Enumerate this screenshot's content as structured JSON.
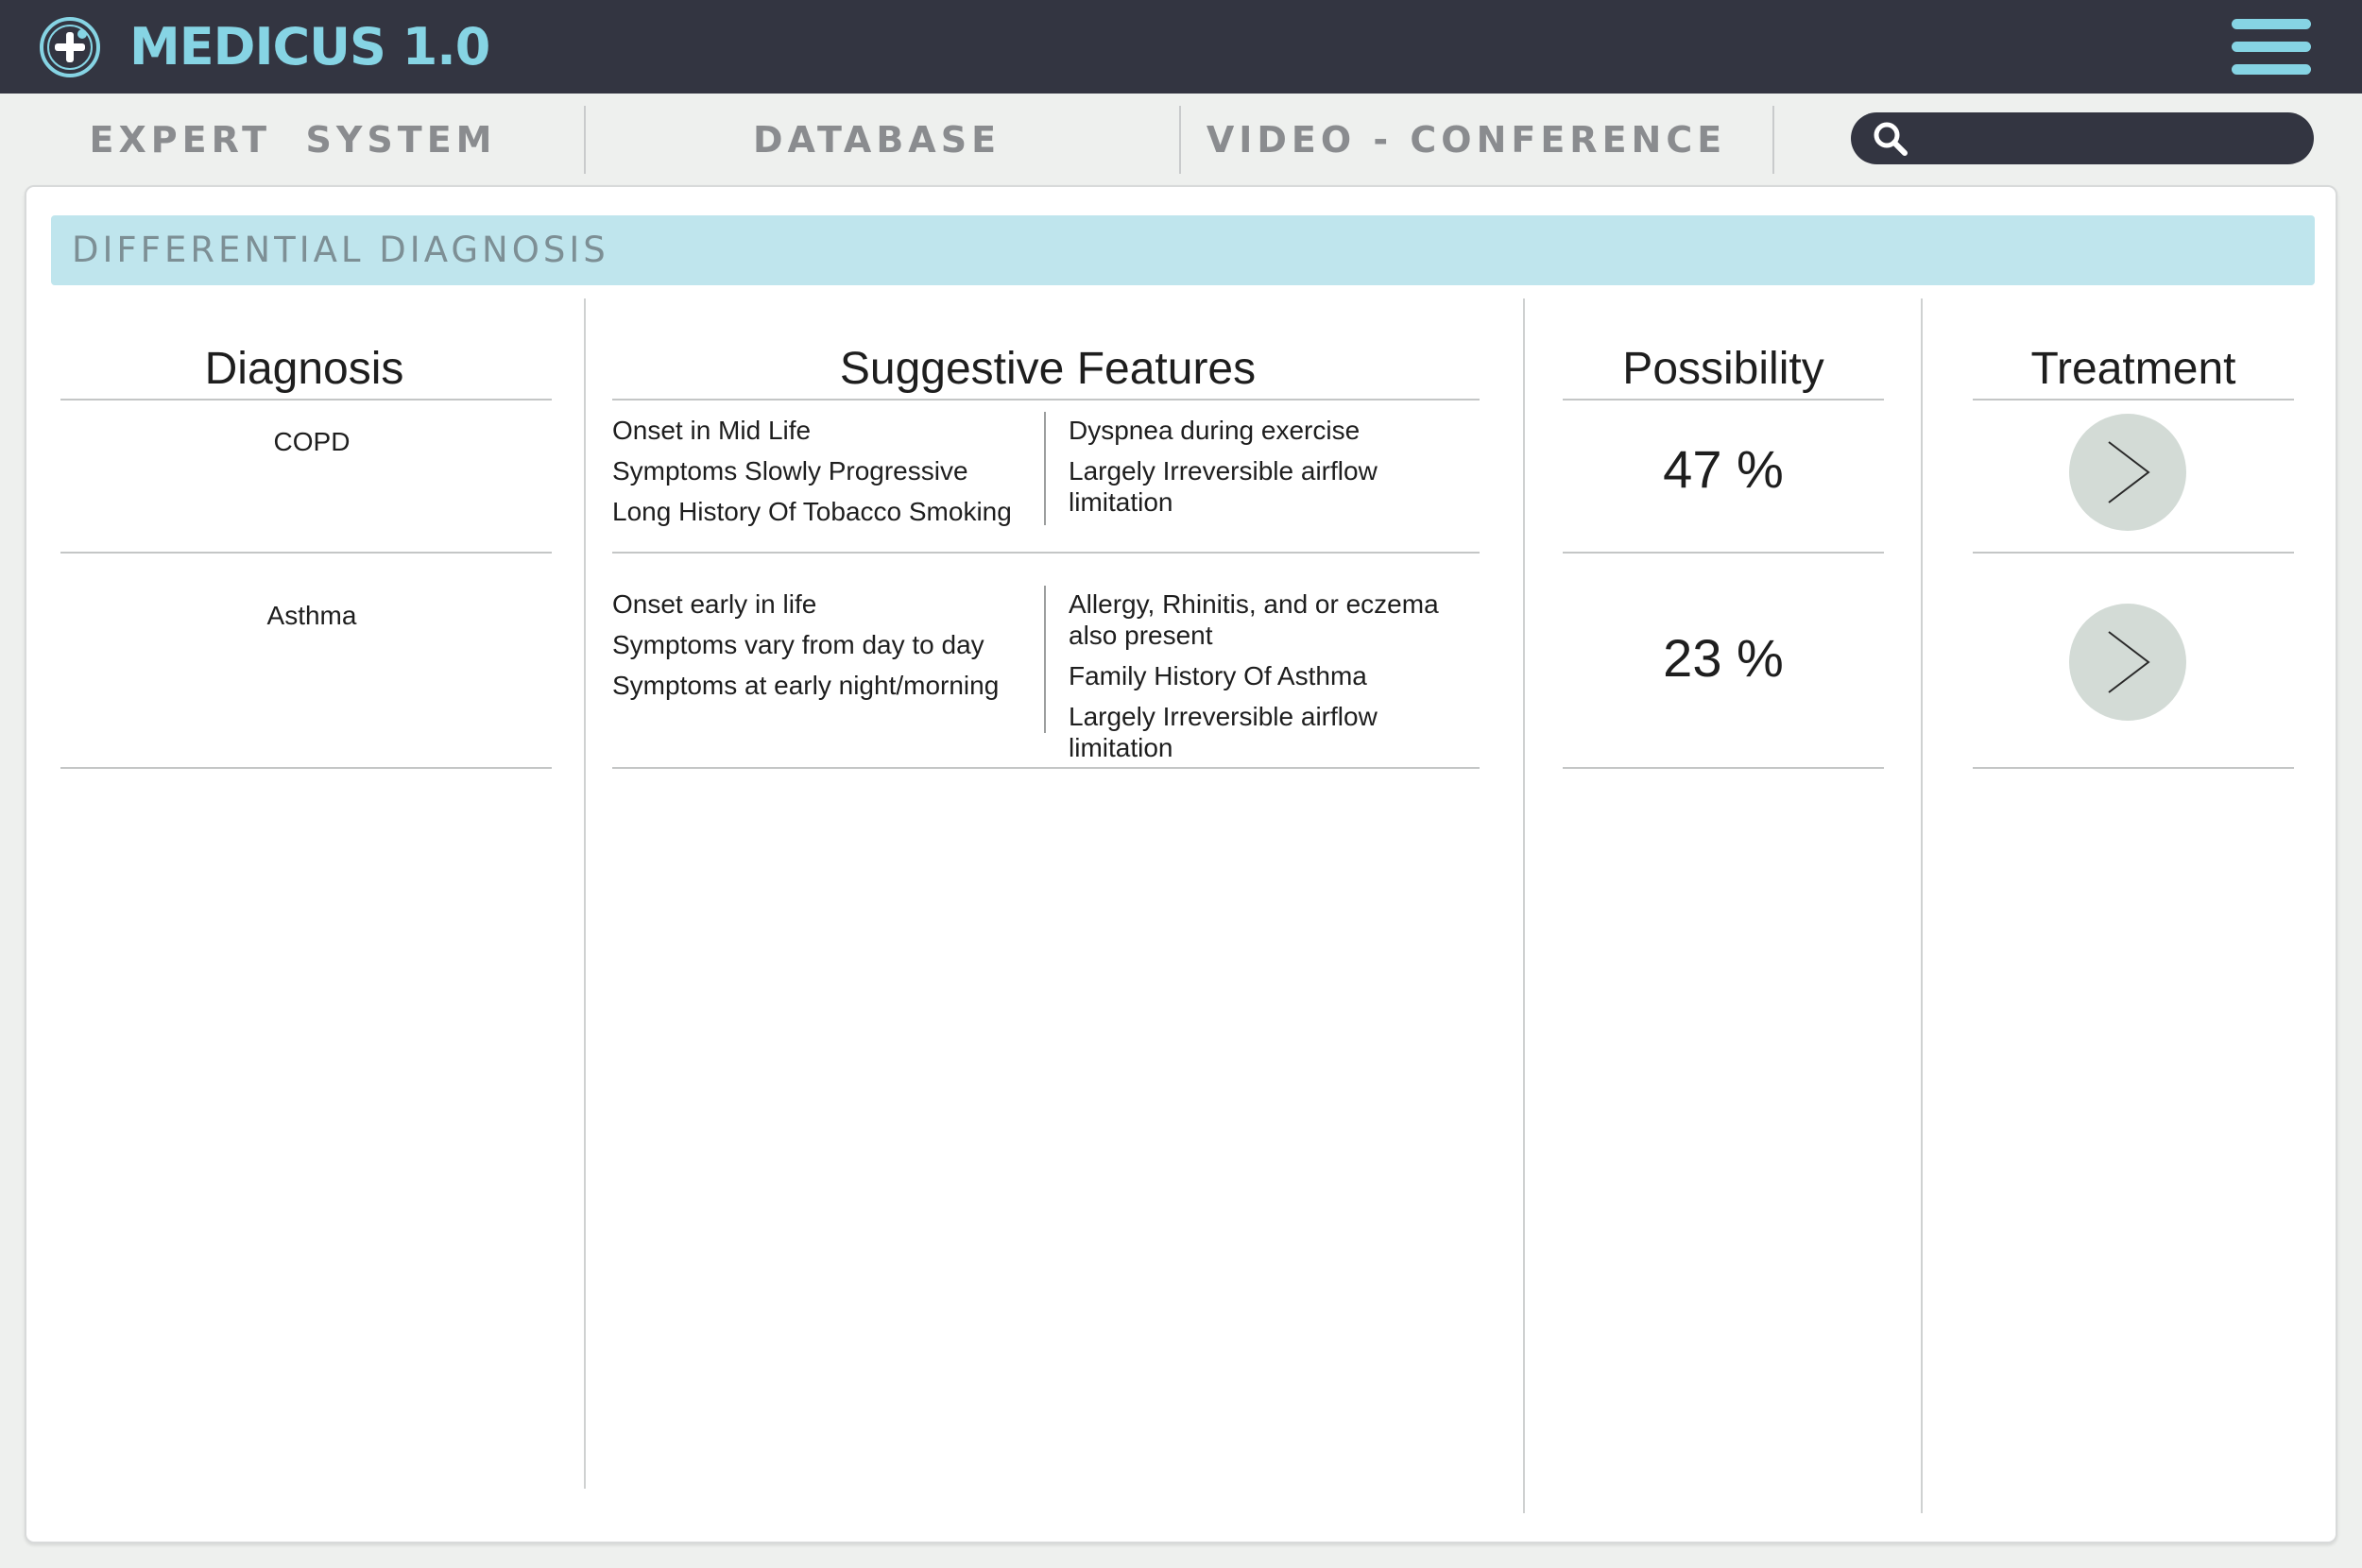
{
  "app": {
    "title": "MEDICUS 1.0",
    "accent_color": "#86d4e4",
    "bar_color": "#333541",
    "logo_icon": "medical-plus-icon",
    "menu_icon": "hamburger-icon"
  },
  "nav": {
    "tabs": [
      {
        "label": "EXPERT  SYSTEM"
      },
      {
        "label": "DATABASE"
      },
      {
        "label": "VIDEO - CONFERENCE"
      }
    ],
    "search": {
      "icon": "search-icon",
      "placeholder": "",
      "value": ""
    }
  },
  "section": {
    "title": "DIFFERENTIAL DIAGNOSIS",
    "header_color": "#bfe5ed"
  },
  "table": {
    "columns": [
      "Diagnosis",
      "Suggestive Features",
      "Possibility",
      "Treatment"
    ],
    "rows": [
      {
        "diagnosis": "COPD",
        "features_left": [
          "Onset in Mid Life",
          "Symptoms Slowly Progressive",
          "Long History Of Tobacco Smoking"
        ],
        "features_right": [
          "Dyspnea during exercise",
          "Largely Irreversible airflow limitation"
        ],
        "possibility": "47 %",
        "treatment_icon": "chevron-right-icon"
      },
      {
        "diagnosis": "Asthma",
        "features_left": [
          "Onset early in life",
          "Symptoms vary from day to day",
          "Symptoms at early night/morning"
        ],
        "features_right": [
          "Allergy, Rhinitis, and or eczema also present",
          "Family History Of Asthma",
          "Largely Irreversible airflow limitation"
        ],
        "possibility": "23 %",
        "treatment_icon": "chevron-right-icon"
      }
    ]
  }
}
